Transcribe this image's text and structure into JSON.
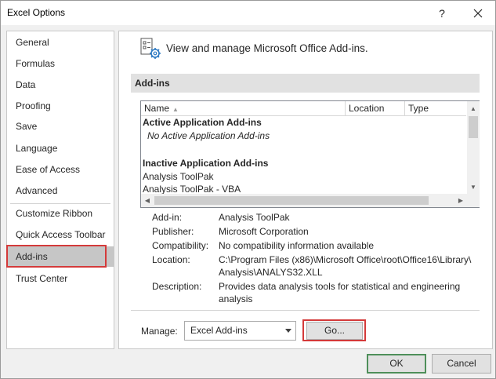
{
  "window": {
    "title": "Excel Options",
    "help_label": "?",
    "colors": {
      "selection_border": "#d43a3a",
      "ok_border": "#4e8f5a",
      "nav_selected": "#c6c6c6"
    }
  },
  "sidebar": {
    "items": [
      {
        "label": "General"
      },
      {
        "label": "Formulas"
      },
      {
        "label": "Data"
      },
      {
        "label": "Proofing"
      },
      {
        "label": "Save"
      },
      {
        "label": "Language"
      },
      {
        "label": "Ease of Access"
      },
      {
        "label": "Advanced"
      },
      {
        "label": "Customize Ribbon"
      },
      {
        "label": "Quick Access Toolbar"
      },
      {
        "label": "Add-ins",
        "selected": true
      },
      {
        "label": "Trust Center"
      }
    ]
  },
  "main": {
    "header_icon": "addins-gear-icon",
    "header_text": "View and manage Microsoft Office Add-ins.",
    "section_title": "Add-ins",
    "list": {
      "columns": [
        "Name",
        "Location",
        "Type"
      ],
      "sort_indicator": "▲",
      "groups": [
        {
          "title": "Active Application Add-ins",
          "items": [
            "No Active Application Add-ins"
          ]
        },
        {
          "title": "Inactive Application Add-ins",
          "items": [
            "Analysis ToolPak",
            "Analysis ToolPak - VBA"
          ]
        }
      ]
    },
    "details": {
      "addin_label": "Add-in:",
      "addin_value": "Analysis ToolPak",
      "publisher_label": "Publisher:",
      "publisher_value": "Microsoft Corporation",
      "compat_label": "Compatibility:",
      "compat_value": "No compatibility information available",
      "location_label": "Location:",
      "location_value_1": "C:\\Program Files (x86)\\Microsoft Office\\root\\Office16\\Library\\",
      "location_value_2": "Analysis\\ANALYS32.XLL",
      "description_label": "Description:",
      "description_value_1": "Provides data analysis tools for statistical and engineering",
      "description_value_2": "analysis"
    },
    "manage": {
      "label": "Manage:",
      "selected": "Excel Add-ins",
      "go_label": "Go..."
    }
  },
  "footer": {
    "ok_label": "OK",
    "cancel_label": "Cancel"
  }
}
